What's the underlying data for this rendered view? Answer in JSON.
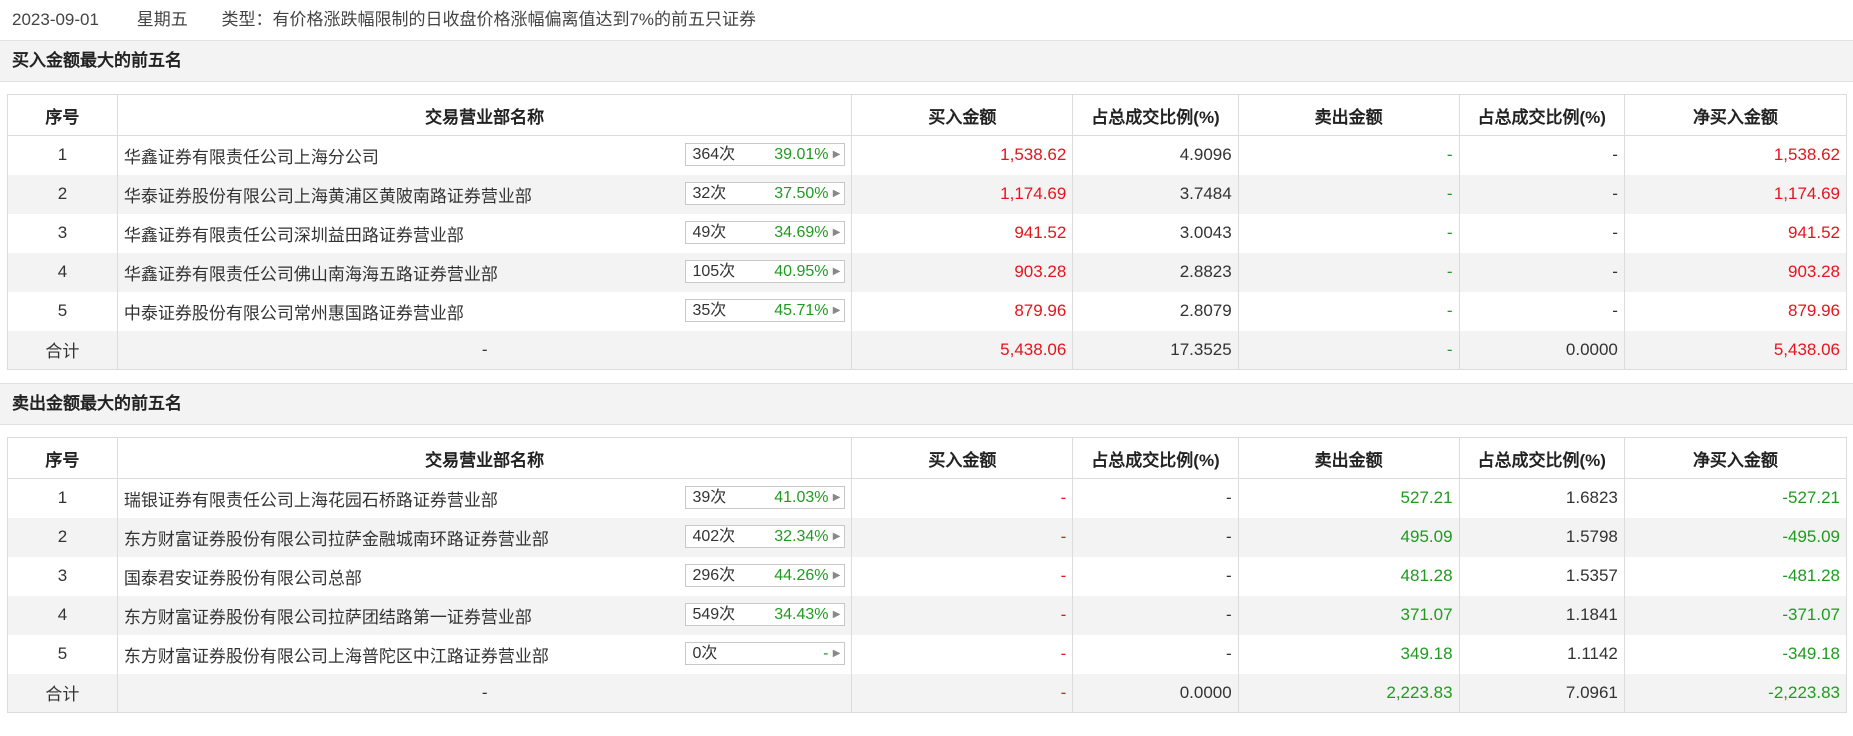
{
  "header": {
    "date": "2023-09-01",
    "weekday": "星期五",
    "type_text": "类型：有价格涨跌幅限制的日收盘价格涨幅偏离值达到7%的前五只证券"
  },
  "columns": [
    "序号",
    "交易营业部名称",
    "买入金额",
    "占总成交比例(%)",
    "卖出金额",
    "占总成交比例(%)",
    "净买入金额"
  ],
  "buy": {
    "title": "买入金额最大的前五名",
    "rows": [
      {
        "no": "1",
        "name": "华鑫证券有限责任公司上海分公司",
        "count": "364次",
        "rate": "39.01%",
        "buy": "1,538.62",
        "buy_pct": "4.9096",
        "sell": "-",
        "sell_pct": "-",
        "net": "1,538.62"
      },
      {
        "no": "2",
        "name": "华泰证券股份有限公司上海黄浦区黄陂南路证券营业部",
        "count": "32次",
        "rate": "37.50%",
        "buy": "1,174.69",
        "buy_pct": "3.7484",
        "sell": "-",
        "sell_pct": "-",
        "net": "1,174.69"
      },
      {
        "no": "3",
        "name": "华鑫证券有限责任公司深圳益田路证券营业部",
        "count": "49次",
        "rate": "34.69%",
        "buy": "941.52",
        "buy_pct": "3.0043",
        "sell": "-",
        "sell_pct": "-",
        "net": "941.52"
      },
      {
        "no": "4",
        "name": "华鑫证券有限责任公司佛山南海海五路证券营业部",
        "count": "105次",
        "rate": "40.95%",
        "buy": "903.28",
        "buy_pct": "2.8823",
        "sell": "-",
        "sell_pct": "-",
        "net": "903.28"
      },
      {
        "no": "5",
        "name": "中泰证券股份有限公司常州惠国路证券营业部",
        "count": "35次",
        "rate": "45.71%",
        "buy": "879.96",
        "buy_pct": "2.8079",
        "sell": "-",
        "sell_pct": "-",
        "net": "879.96"
      }
    ],
    "total": {
      "label": "合计",
      "name": "-",
      "buy": "5,438.06",
      "buy_pct": "17.3525",
      "sell": "-",
      "sell_pct": "0.0000",
      "net": "5,438.06"
    }
  },
  "sell": {
    "title": "卖出金额最大的前五名",
    "rows": [
      {
        "no": "1",
        "name": "瑞银证券有限责任公司上海花园石桥路证券营业部",
        "count": "39次",
        "rate": "41.03%",
        "buy": "-",
        "buy_pct": "-",
        "sell": "527.21",
        "sell_pct": "1.6823",
        "net": "-527.21"
      },
      {
        "no": "2",
        "name": "东方财富证券股份有限公司拉萨金融城南环路证券营业部",
        "count": "402次",
        "rate": "32.34%",
        "buy": "-",
        "buy_pct": "-",
        "sell": "495.09",
        "sell_pct": "1.5798",
        "net": "-495.09"
      },
      {
        "no": "3",
        "name": "国泰君安证券股份有限公司总部",
        "count": "296次",
        "rate": "44.26%",
        "buy": "-",
        "buy_pct": "-",
        "sell": "481.28",
        "sell_pct": "1.5357",
        "net": "-481.28"
      },
      {
        "no": "4",
        "name": "东方财富证券股份有限公司拉萨团结路第一证券营业部",
        "count": "549次",
        "rate": "34.43%",
        "buy": "-",
        "buy_pct": "-",
        "sell": "371.07",
        "sell_pct": "1.1841",
        "net": "-371.07"
      },
      {
        "no": "5",
        "name": "东方财富证券股份有限公司上海普陀区中江路证券营业部",
        "count": "0次",
        "rate": "-",
        "buy": "-",
        "buy_pct": "-",
        "sell": "349.18",
        "sell_pct": "1.1142",
        "net": "-349.18"
      }
    ],
    "total": {
      "label": "合计",
      "name": "-",
      "buy": "-",
      "buy_pct": "0.0000",
      "sell": "2,223.83",
      "sell_pct": "7.0961",
      "net": "-2,223.83"
    }
  }
}
